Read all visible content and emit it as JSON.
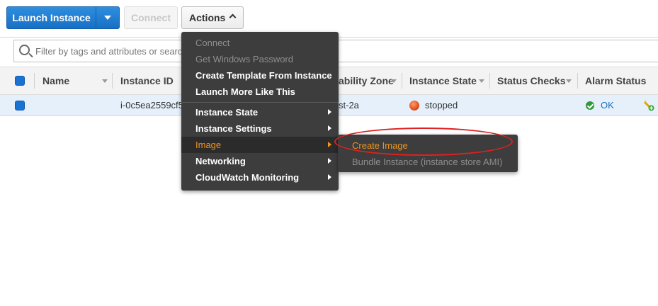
{
  "toolbar": {
    "launch_label": "Launch Instance",
    "connect_label": "Connect",
    "actions_label": "Actions"
  },
  "search": {
    "placeholder": "Filter by tags and attributes or search"
  },
  "table": {
    "columns": [
      "Name",
      "Instance ID",
      "ability Zone",
      "Instance State",
      "Status Checks",
      "Alarm Status"
    ],
    "rows": [
      {
        "name": "",
        "instance_id": "i-0c5ea2559cf5",
        "availability_zone": "st-2a",
        "instance_state": "stopped",
        "status_checks": "",
        "alarm_status": "OK"
      }
    ]
  },
  "actions_menu": {
    "items": [
      {
        "label": "Connect",
        "disabled": true
      },
      {
        "label": "Get Windows Password",
        "disabled": true
      },
      {
        "label": "Create Template From Instance",
        "disabled": false
      },
      {
        "label": "Launch More Like This",
        "disabled": false
      },
      {
        "label": "Instance State",
        "submenu": true
      },
      {
        "label": "Instance Settings",
        "submenu": true
      },
      {
        "label": "Image",
        "submenu": true,
        "active": true
      },
      {
        "label": "Networking",
        "submenu": true
      },
      {
        "label": "CloudWatch Monitoring",
        "submenu": true
      }
    ]
  },
  "image_submenu": {
    "items": [
      {
        "label": "Create Image",
        "highlighted": true
      },
      {
        "label": "Bundle Instance (instance store AMI)",
        "disabled": true
      }
    ]
  },
  "colors": {
    "primary_button": "#1770c5",
    "menu_bg": "#3d3d3d",
    "menu_active_text": "#f0931e",
    "annotation_ellipse": "#e02020",
    "stopped_dot": "#e0521c",
    "ok_green": "#2e9a3a"
  },
  "icons": [
    "search-icon",
    "caret-down-icon",
    "chevron-up-icon",
    "sort-icon",
    "chevron-right-icon",
    "stopped-status-icon",
    "check-icon",
    "alarm-add-icon"
  ]
}
